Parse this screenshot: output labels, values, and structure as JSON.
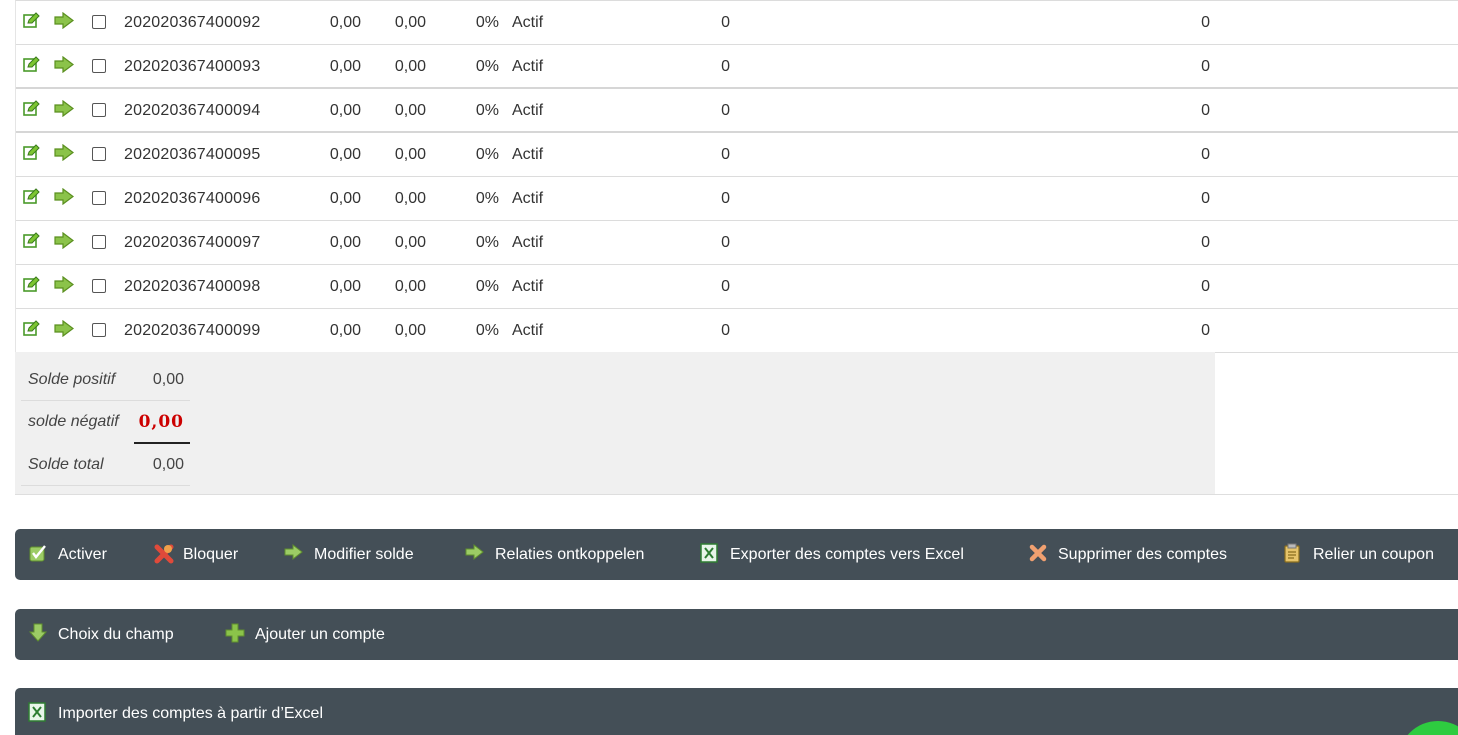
{
  "accounts": [
    {
      "id": "202020367400092",
      "v1": "0,00",
      "v2": "0,00",
      "pct": "0%",
      "status": "Actif",
      "a": "0",
      "b": "0"
    },
    {
      "id": "202020367400093",
      "v1": "0,00",
      "v2": "0,00",
      "pct": "0%",
      "status": "Actif",
      "a": "0",
      "b": "0"
    },
    {
      "id": "202020367400094",
      "v1": "0,00",
      "v2": "0,00",
      "pct": "0%",
      "status": "Actif",
      "a": "0",
      "b": "0"
    },
    {
      "id": "202020367400095",
      "v1": "0,00",
      "v2": "0,00",
      "pct": "0%",
      "status": "Actif",
      "a": "0",
      "b": "0"
    },
    {
      "id": "202020367400096",
      "v1": "0,00",
      "v2": "0,00",
      "pct": "0%",
      "status": "Actif",
      "a": "0",
      "b": "0"
    },
    {
      "id": "202020367400097",
      "v1": "0,00",
      "v2": "0,00",
      "pct": "0%",
      "status": "Actif",
      "a": "0",
      "b": "0"
    },
    {
      "id": "202020367400098",
      "v1": "0,00",
      "v2": "0,00",
      "pct": "0%",
      "status": "Actif",
      "a": "0",
      "b": "0"
    },
    {
      "id": "202020367400099",
      "v1": "0,00",
      "v2": "0,00",
      "pct": "0%",
      "status": "Actif",
      "a": "0",
      "b": "0"
    }
  ],
  "row_icons": {
    "edit": "edit-icon",
    "open": "arrow-right-icon"
  },
  "totals": {
    "positive_label": "Solde positif",
    "positive_value": "0,00",
    "negative_label": "solde négatif",
    "negative_value": "0,00",
    "total_label": "Solde total",
    "total_value": "0,00"
  },
  "toolbar_1": {
    "activate": "Activer",
    "block": "Bloquer",
    "modify_balance": "Modifier solde",
    "unlink_relations": "Relaties ontkoppelen",
    "export_excel": "Exporter des comptes vers Excel",
    "delete_accounts": "Supprimer des comptes",
    "link_coupon": "Relier un coupon"
  },
  "toolbar_2": {
    "choose_field": "Choix du champ",
    "add_account": "Ajouter un compte"
  },
  "toolbar_3": {
    "import_excel": "Importer des comptes à partir d’Excel"
  },
  "colors": {
    "toolbar_bg": "#444f57",
    "negative_value": "#cc0000",
    "icon_green": "#7cc531",
    "chat_green": "#2ecc40"
  }
}
